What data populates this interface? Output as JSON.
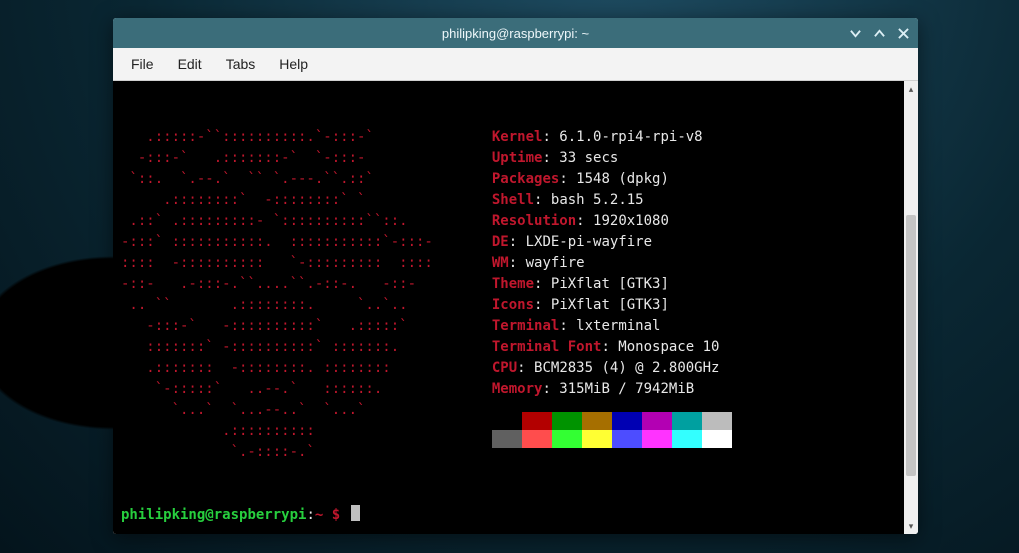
{
  "window": {
    "title": "philipking@raspberrypi: ~"
  },
  "menubar": {
    "items": [
      "File",
      "Edit",
      "Tabs",
      "Help"
    ]
  },
  "neofetch": {
    "ascii_lines": [
      "   .:::::-``::::::::::.`-:::-`",
      "  -:::-`   .:::::::-`  `-:::-",
      " `::.  `.--.`  `` `.---.``.::`",
      "     .::::::::`  -::::::::` `",
      " .::` .:::::::::- `::::::::::``::.",
      "-:::` :::::::::::.  :::::::::::`-:::-",
      "::::  -::::::::::   `-:::::::::  ::::",
      "-::-   .-:::-.``....``.-::-.   -::-",
      " .. ``       .::::::::.     `..`..",
      "   -:::-`   -::::::::::`   .:::::`",
      "   :::::::` -::::::::::` :::::::.",
      "   .:::::::  -::::::::. ::::::::",
      "    `-:::::`   ..--.`   ::::::.",
      "      `...`  `...--..`  `...`",
      "            .::::::::::",
      "             `.-::::-.`"
    ],
    "entries": [
      {
        "label": "Kernel",
        "value": "6.1.0-rpi4-rpi-v8"
      },
      {
        "label": "Uptime",
        "value": "33 secs"
      },
      {
        "label": "Packages",
        "value": "1548 (dpkg)"
      },
      {
        "label": "Shell",
        "value": "bash 5.2.15"
      },
      {
        "label": "Resolution",
        "value": "1920x1080"
      },
      {
        "label": "DE",
        "value": "LXDE-pi-wayfire"
      },
      {
        "label": "WM",
        "value": "wayfire"
      },
      {
        "label": "Theme",
        "value": "PiXflat [GTK3]"
      },
      {
        "label": "Icons",
        "value": "PiXflat [GTK3]"
      },
      {
        "label": "Terminal",
        "value": "lxterminal"
      },
      {
        "label": "Terminal Font",
        "value": "Monospace 10"
      },
      {
        "label": "CPU",
        "value": "BCM2835 (4) @ 2.800GHz"
      },
      {
        "label": "Memory",
        "value": "315MiB / 7942MiB"
      }
    ],
    "swatches": {
      "row1": [
        "#000000",
        "#b30000",
        "#009300",
        "#a66f00",
        "#0000b3",
        "#b300b3",
        "#00a0a0",
        "#bcbcbc"
      ],
      "row2": [
        "#606060",
        "#ff4d4d",
        "#33ff33",
        "#ffff33",
        "#4d4dff",
        "#ff33ff",
        "#33ffff",
        "#ffffff"
      ]
    }
  },
  "prompt": {
    "user": "philipking",
    "host": "raspberrypi",
    "separator": ":",
    "path": "~",
    "symbol": "$"
  }
}
